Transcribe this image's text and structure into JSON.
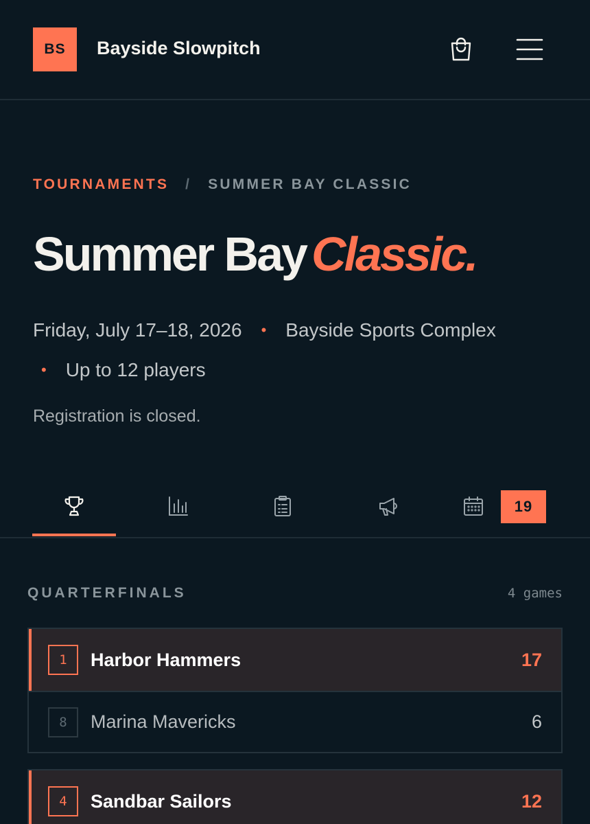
{
  "header": {
    "logo_text": "BS",
    "site_name": "Bayside Slowpitch",
    "cart_icon": "shopping-bag-icon",
    "menu_icon": "hamburger-menu-icon"
  },
  "breadcrumb": {
    "parent": "TOURNAMENTS",
    "separator": "/",
    "current": "SUMMER BAY CLASSIC"
  },
  "title": {
    "main": "Summer Bay",
    "accent": "Classic."
  },
  "meta": {
    "date": "Friday, July 17–18, 2026",
    "location": "Bayside Sports Complex",
    "roster": "Up to 12 players",
    "bullet": "•"
  },
  "registration_status": "Registration is closed.",
  "tabs": [
    {
      "icon": "trophy-icon",
      "active": true
    },
    {
      "icon": "bar-chart-icon",
      "active": false
    },
    {
      "icon": "clipboard-icon",
      "active": false
    },
    {
      "icon": "megaphone-icon",
      "active": false
    },
    {
      "icon": "calendar-icon",
      "active": false
    }
  ],
  "date_badge": "19",
  "bracket": {
    "round_title": "QUARTERFINALS",
    "game_count": "4 games",
    "matchups": [
      {
        "winner": {
          "seed": "1",
          "name": "Harbor Hammers",
          "score": "17"
        },
        "loser": {
          "seed": "8",
          "name": "Marina Mavericks",
          "score": "6"
        }
      },
      {
        "winner": {
          "seed": "4",
          "name": "Sandbar Sailors",
          "score": "12"
        }
      }
    ]
  },
  "colors": {
    "background": "#0b1821",
    "accent": "#ff7452",
    "text": "#f3f1ec",
    "muted": "#8a959b"
  }
}
